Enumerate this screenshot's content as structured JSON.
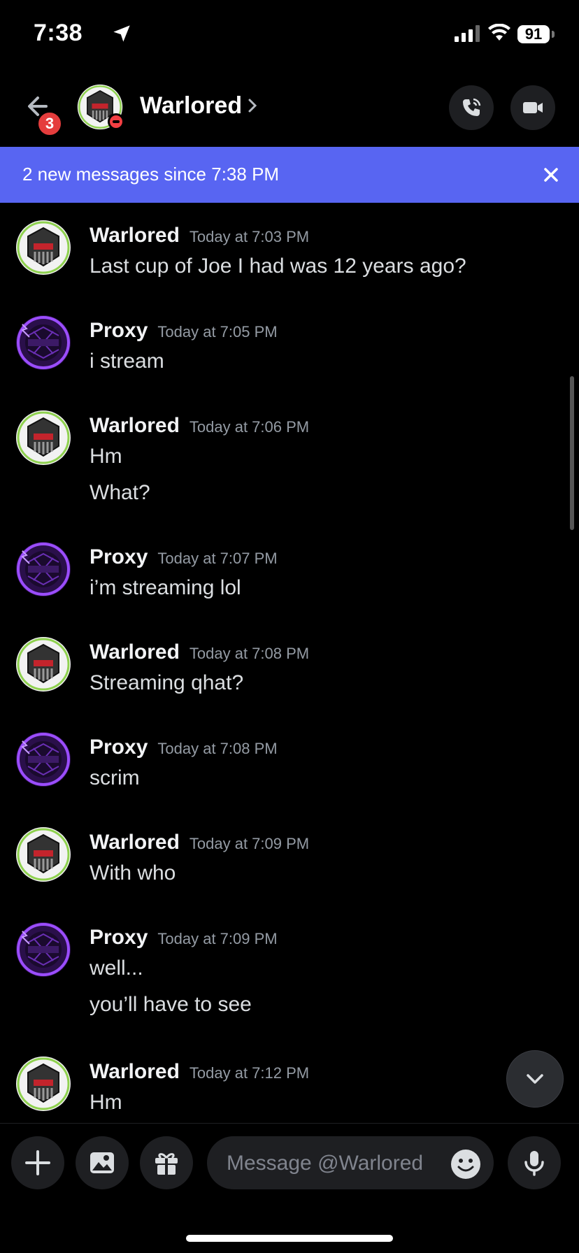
{
  "status_bar": {
    "time": "7:38",
    "battery": "91"
  },
  "header": {
    "back_badge": "3",
    "title": "Warlored"
  },
  "banner": {
    "text": "2 new messages since 7:38 PM"
  },
  "messages": [
    {
      "author": "Warlored",
      "timestamp": "Today at 7:03 PM",
      "lines": [
        "Last cup of Joe I had was 12 years ago?"
      ]
    },
    {
      "author": "Proxy",
      "timestamp": "Today at 7:05 PM",
      "lines": [
        "i stream"
      ]
    },
    {
      "author": "Warlored",
      "timestamp": "Today at 7:06 PM",
      "lines": [
        "Hm",
        "What?"
      ]
    },
    {
      "author": "Proxy",
      "timestamp": "Today at 7:07 PM",
      "lines": [
        "i’m streaming lol"
      ]
    },
    {
      "author": "Warlored",
      "timestamp": "Today at 7:08 PM",
      "lines": [
        "Streaming qhat?"
      ]
    },
    {
      "author": "Proxy",
      "timestamp": "Today at 7:08 PM",
      "lines": [
        "scrim"
      ]
    },
    {
      "author": "Warlored",
      "timestamp": "Today at 7:09 PM",
      "lines": [
        "With who"
      ]
    },
    {
      "author": "Proxy",
      "timestamp": "Today at 7:09 PM",
      "lines": [
        "well...",
        "you’ll have to see"
      ]
    },
    {
      "author": "Warlored",
      "timestamp": "Today at 7:12 PM",
      "lines": [
        "Hm"
      ]
    }
  ],
  "composer": {
    "placeholder": "Message @Warlored"
  },
  "colors": {
    "banner": "#5865f2",
    "badge": "#e53d3d",
    "dnd": "#f23f43",
    "background": "#000000"
  },
  "icons": [
    "location-arrow-icon",
    "signal-icon",
    "wifi-icon",
    "back-arrow-icon",
    "chevron-right-icon",
    "phone-icon",
    "video-camera-icon",
    "close-icon",
    "chevron-down-icon",
    "plus-icon",
    "image-icon",
    "gift-icon",
    "emoji-icon",
    "microphone-icon"
  ]
}
